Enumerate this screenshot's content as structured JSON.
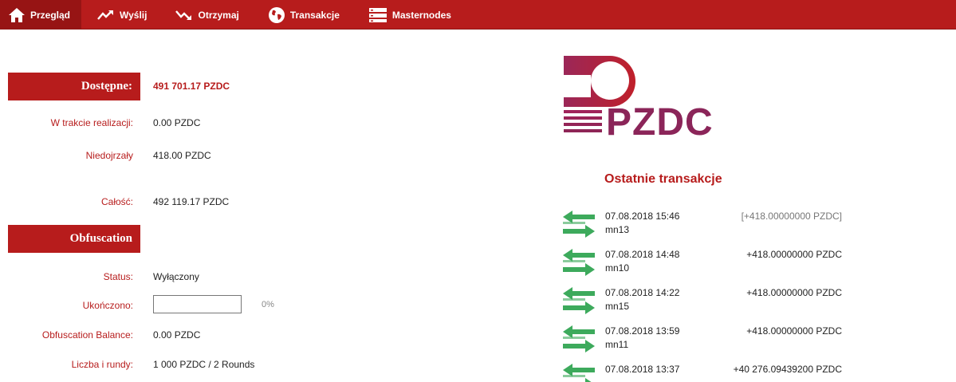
{
  "nav": {
    "tabs": [
      {
        "label": "Przegląd",
        "icon": "home-icon",
        "active": true
      },
      {
        "label": "Wyślij",
        "icon": "send-icon",
        "active": false
      },
      {
        "label": "Otrzymaj",
        "icon": "receive-icon",
        "active": false
      },
      {
        "label": "Transakcje",
        "icon": "globe-icon",
        "active": false
      },
      {
        "label": "Masternodes",
        "icon": "server-icon",
        "active": false
      }
    ]
  },
  "balances": {
    "available_header": "Dostępne:",
    "available_value": "491 701.17 PZDC",
    "pending_label": "W trakcie realizacji:",
    "pending_value": "0.00 PZDC",
    "immature_label": "Niedojrzały",
    "immature_value": "418.00 PZDC",
    "total_label": "Całość:",
    "total_value": "492 119.17 PZDC"
  },
  "obfuscation": {
    "header": "Obfuscation",
    "status_label": "Status:",
    "status_value": "Wyłączony",
    "completed_label": "Ukończono:",
    "completed_percent": "0%",
    "completed_fraction": 0,
    "balance_label": "Obfuscation Balance:",
    "balance_value": "0.00 PZDC",
    "rounds_label": "Liczba i rundy:",
    "rounds_value": "1 000 PZDC / 2 Rounds"
  },
  "logo": {
    "text": "PZDC"
  },
  "recent": {
    "title": "Ostatnie transakcje",
    "transactions": [
      {
        "date": "07.08.2018 15:46",
        "label": "mn13",
        "amount": "[+418.00000000 PZDC]",
        "unconfirmed": true
      },
      {
        "date": "07.08.2018 14:48",
        "label": "mn10",
        "amount": "+418.00000000 PZDC",
        "unconfirmed": false
      },
      {
        "date": "07.08.2018 14:22",
        "label": "mn15",
        "amount": "+418.00000000 PZDC",
        "unconfirmed": false
      },
      {
        "date": "07.08.2018 13:59",
        "label": "mn11",
        "amount": "+418.00000000 PZDC",
        "unconfirmed": false
      },
      {
        "date": "07.08.2018 13:37",
        "label": "",
        "amount": "+40 276.09439200 PZDC",
        "unconfirmed": false
      }
    ]
  },
  "colors": {
    "accent": "#b71c1c",
    "brand": "#8b2559",
    "tx_icon": "#3daa5c"
  }
}
